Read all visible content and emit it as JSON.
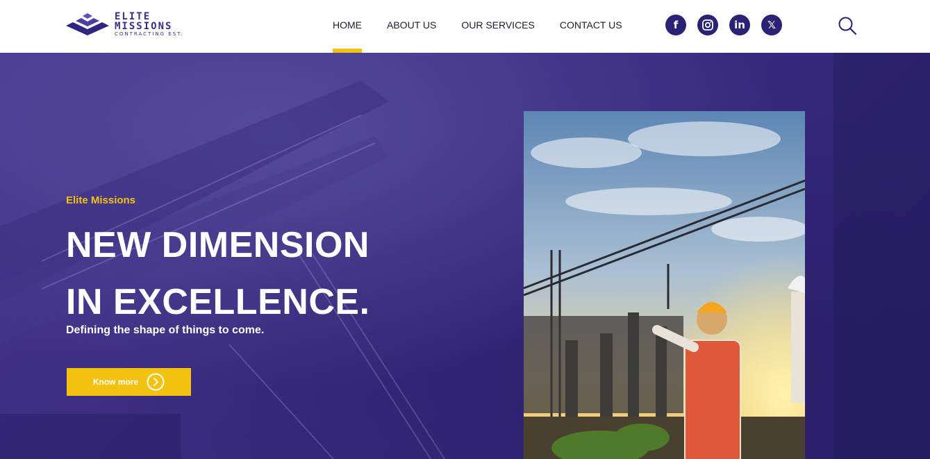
{
  "brand": {
    "line1": "ELITE",
    "line2": "MISSIONS",
    "line3": "CONTRACTING EST."
  },
  "nav": {
    "items": [
      {
        "label": "HOME",
        "active": true
      },
      {
        "label": "ABOUT US",
        "active": false
      },
      {
        "label": "OUR SERVICES",
        "active": false
      },
      {
        "label": "CONTACT US",
        "active": false
      }
    ]
  },
  "socials": {
    "facebook": {
      "icon": "facebook-icon",
      "glyph": "f"
    },
    "instagram": {
      "icon": "instagram-icon"
    },
    "linkedin": {
      "icon": "linkedin-icon",
      "glyph": "in"
    },
    "x": {
      "icon": "x-icon",
      "glyph": "𝕏"
    }
  },
  "search": {
    "icon": "search-icon"
  },
  "hero": {
    "eyebrow": "Elite Missions",
    "headline_line1": "NEW DIMENSION",
    "headline_line2": "IN EXCELLENCE.",
    "subline": "Defining the shape of things to come.",
    "cta_label": "Know more",
    "cta_icon": "chevron-right-circle-icon"
  },
  "colors": {
    "accent": "#f3c20f",
    "brand": "#2a2375",
    "hero_bg": "#3f2f87",
    "text_dark": "#1c1c2a"
  }
}
